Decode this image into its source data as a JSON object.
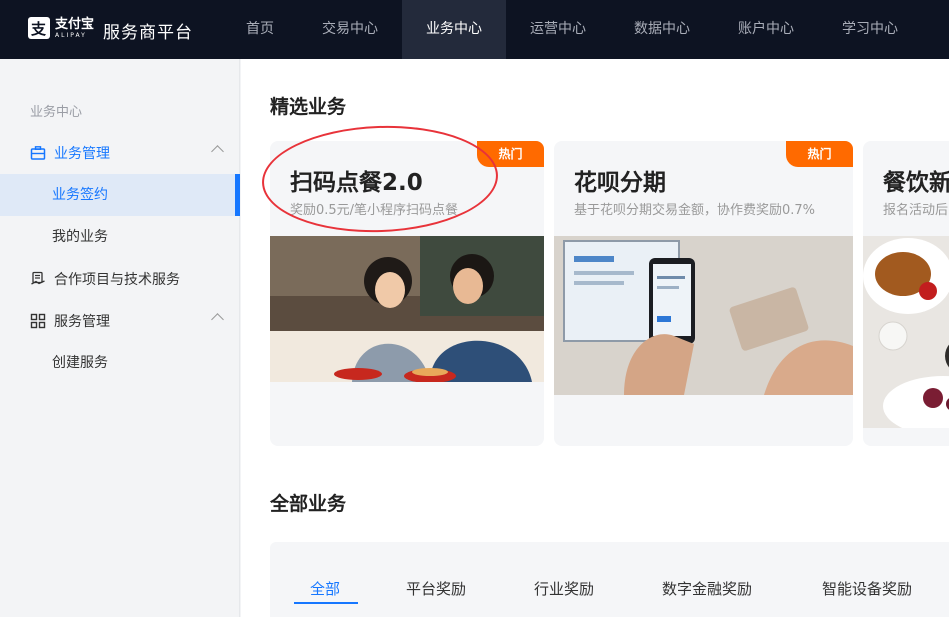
{
  "brand": {
    "logo_cn": "支付宝",
    "logo_en": "ALIPAY",
    "platform_title": "服务商平台"
  },
  "nav": {
    "items": [
      {
        "label": "首页"
      },
      {
        "label": "交易中心"
      },
      {
        "label": "业务中心"
      },
      {
        "label": "运营中心"
      },
      {
        "label": "数据中心"
      },
      {
        "label": "账户中心"
      },
      {
        "label": "学习中心"
      }
    ],
    "active": "业务中心"
  },
  "sidebar": {
    "heading": "业务中心",
    "groups": [
      {
        "label": "业务管理",
        "icon": "briefcase-icon",
        "expanded": true
      },
      {
        "label": "合作项目与技术服务",
        "icon": "handshake-icon"
      },
      {
        "label": "服务管理",
        "icon": "grid-apps-icon",
        "expanded": true
      }
    ],
    "sub_items": [
      {
        "label": "业务签约",
        "active": true
      },
      {
        "label": "我的业务"
      },
      {
        "label": "创建服务"
      }
    ]
  },
  "featured": {
    "title": "精选业务",
    "cards": [
      {
        "title": "扫码点餐2.0",
        "desc": "奖励0.5元/笔小程序扫码点餐",
        "badge": "热门",
        "image": "couple-eating-noodles-photo"
      },
      {
        "title": "花呗分期",
        "desc": "基于花呗分期交易金额，协作费奖励0.7%",
        "badge": "热门",
        "image": "phone-payment-photo"
      },
      {
        "title": "餐饮新",
        "desc": "报名活动后",
        "image": "restaurant-dishes-photo"
      }
    ]
  },
  "all_business": {
    "title": "全部业务",
    "tabs": [
      {
        "label": "全部",
        "active": true
      },
      {
        "label": "平台奖励"
      },
      {
        "label": "行业奖励"
      },
      {
        "label": "数字金融奖励"
      },
      {
        "label": "智能设备奖励"
      }
    ]
  },
  "colors": {
    "topbar": "#0d1322",
    "accent": "#1677ff",
    "hot_badge": "#ff6a00",
    "annotation_ring": "#e8333a"
  }
}
